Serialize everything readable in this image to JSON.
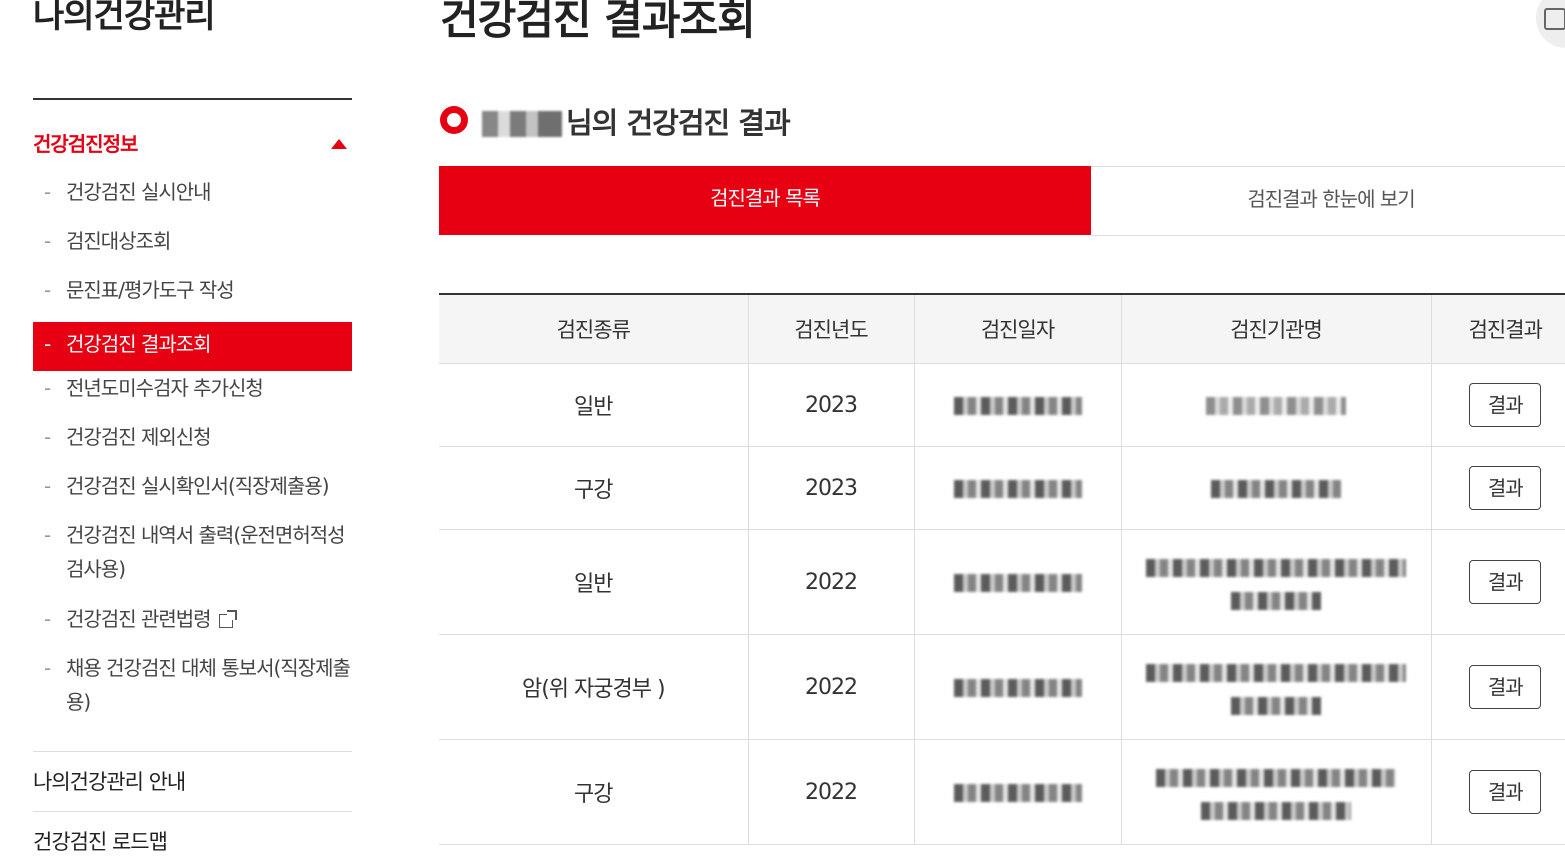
{
  "sidebar": {
    "title": "나의건강관리",
    "section": "건강검진정보",
    "items": [
      {
        "label": "건강검진 실시안내",
        "lines": 1
      },
      {
        "label": "검진대상조회",
        "lines": 1
      },
      {
        "label": "문진표/평가도구 작성",
        "lines": 1
      },
      {
        "label": "건강검진 결과조회",
        "lines": 1
      },
      {
        "label": "전년도미수검자 추가신청",
        "lines": 1
      },
      {
        "label": "건강검진 제외신청",
        "lines": 1
      },
      {
        "label": "건강검진 실시확인서(직장제출용)",
        "lines": 1
      },
      {
        "label": "건강검진 내역서 출력(운전면허적성검사용)",
        "lines": 2
      },
      {
        "label": "건강검진 관련법령",
        "lines": 1
      },
      {
        "label": "채용 건강검진 대체 통보서(직장제출용)",
        "lines": 2
      }
    ],
    "active_index": 3,
    "bottom_links": [
      "나의건강관리 안내",
      "건강검진 로드맵"
    ]
  },
  "header": {
    "page_title": "건강검진 결과조회",
    "section_suffix": "님의 건강검진 결과"
  },
  "tabs": [
    {
      "label": "검진결과 목록",
      "active": true
    },
    {
      "label": "검진결과 한눈에 보기",
      "active": false
    }
  ],
  "table": {
    "columns": [
      "검진종류",
      "검진년도",
      "검진일자",
      "검진기관명",
      "검진결과"
    ],
    "rows": [
      {
        "type": "일반",
        "year": "2023",
        "button": "결과"
      },
      {
        "type": "구강",
        "year": "2023",
        "button": "결과"
      },
      {
        "type": "일반",
        "year": "2022",
        "button": "결과"
      },
      {
        "type": "암(위 자궁경부 )",
        "year": "2022",
        "button": "결과"
      },
      {
        "type": "구강",
        "year": "2022",
        "button": "결과"
      }
    ]
  },
  "colors": {
    "accent": "#e60012",
    "header_bg": "#f5f5f5",
    "border": "#dddddd"
  },
  "icons": [
    "heart-icon",
    "caret-up-icon",
    "external-link-icon",
    "print-icon"
  ]
}
